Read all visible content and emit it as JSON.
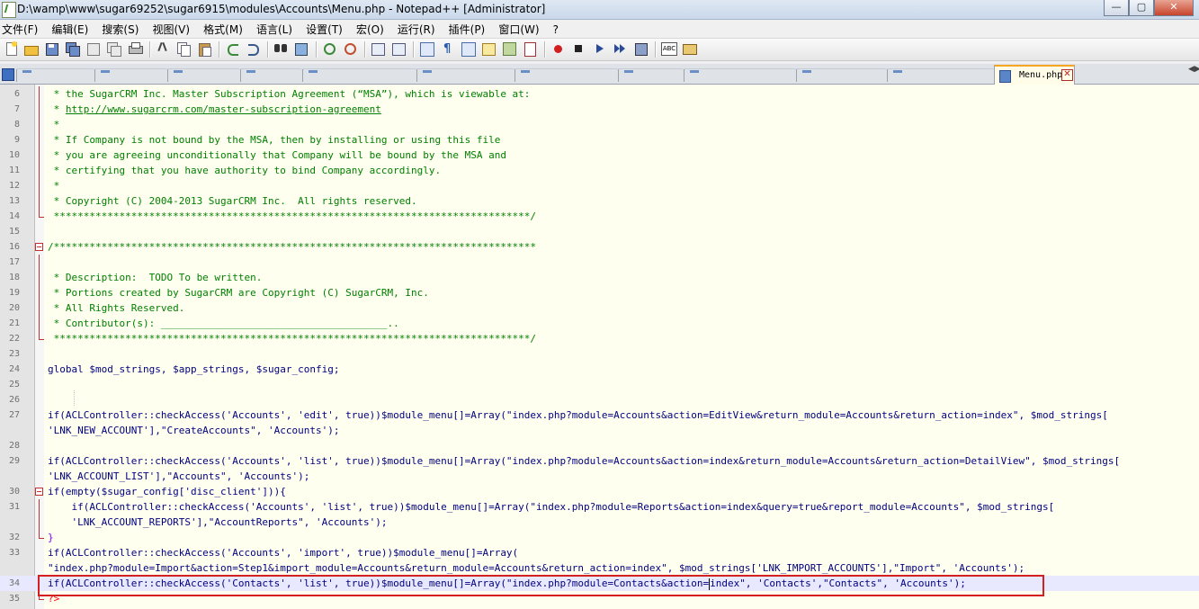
{
  "window": {
    "title": "D:\\wamp\\www\\sugar69252\\sugar6915\\modules\\Accounts\\Menu.php - Notepad++ [Administrator]",
    "minimize": "—",
    "maximize": "▢",
    "close": "✕"
  },
  "menu": [
    "文件(F)",
    "编辑(E)",
    "搜索(S)",
    "视图(V)",
    "格式(M)",
    "语言(L)",
    "设置(T)",
    "宏(O)",
    "运行(R)",
    "插件(P)",
    "窗口(W)",
    "?"
  ],
  "active_tab": {
    "label": "Menu.php",
    "close": "✕"
  },
  "tab_scroll": "◀▶",
  "colors": {
    "editor_bg": "#fffff0",
    "comment": "#008000",
    "keyword": "#0000ff",
    "string": "#808080",
    "highlight_box": "#d42020"
  },
  "editor": {
    "lines": [
      {
        "n": "6",
        "text": " * the SugarCRM Inc. Master Subscription Agreement (“MSA”), which is viewable at:"
      },
      {
        "n": "7",
        "text_pre": " * ",
        "link": "http://www.sugarcrm.com/master-subscription-agreement"
      },
      {
        "n": "8",
        "text": " *"
      },
      {
        "n": "9",
        "text": " * If Company is not bound by the MSA, then by installing or using this file"
      },
      {
        "n": "10",
        "text": " * you are agreeing unconditionally that Company will be bound by the MSA and"
      },
      {
        "n": "11",
        "text": " * certifying that you have authority to bind Company accordingly."
      },
      {
        "n": "12",
        "text": " *"
      },
      {
        "n": "13",
        "text": " * Copyright (C) 2004-2013 SugarCRM Inc.  All rights reserved."
      },
      {
        "n": "14",
        "text": " ********************************************************************************/"
      },
      {
        "n": "15",
        "text": ""
      },
      {
        "n": "16",
        "text": "/*********************************************************************************"
      },
      {
        "n": "17",
        "text": ""
      },
      {
        "n": "18",
        "text": " * Description:  TODO To be written."
      },
      {
        "n": "19",
        "text": " * Portions created by SugarCRM are Copyright (C) SugarCRM, Inc."
      },
      {
        "n": "20",
        "text": " * All Rights Reserved."
      },
      {
        "n": "21",
        "text": " * Contributor(s): ______________________________________.."
      },
      {
        "n": "22",
        "text": " ********************************************************************************/"
      },
      {
        "n": "23",
        "text": ""
      },
      {
        "n": "24",
        "text": "global $mod_strings, $app_strings, $sugar_config;"
      },
      {
        "n": "25",
        "text": ""
      },
      {
        "n": "26",
        "text": ""
      },
      {
        "n": "27",
        "a": "if(ACLController::checkAccess('Accounts', 'edit', true))$module_menu[]=Array(\"index.php?module=Accounts&action=EditView&return_module=Accounts&return_action=index\", $mod_strings[",
        "b": "'LNK_NEW_ACCOUNT'],\"CreateAccounts\", 'Accounts');"
      },
      {
        "n": "28",
        "text": ""
      },
      {
        "n": "29",
        "a": "if(ACLController::checkAccess('Accounts', 'list', true))$module_menu[]=Array(\"index.php?module=Accounts&action=index&return_module=Accounts&return_action=DetailView\", $mod_strings[",
        "b": "'LNK_ACCOUNT_LIST'],\"Accounts\", 'Accounts');"
      },
      {
        "n": "30",
        "text": "if(empty($sugar_config['disc_client'])){"
      },
      {
        "n": "31",
        "a": "    if(ACLController::checkAccess('Accounts', 'list', true))$module_menu[]=Array(\"index.php?module=Reports&action=index&query=true&report_module=Accounts\", $mod_strings[",
        "b": "    'LNK_ACCOUNT_REPORTS'],\"AccountReports\", 'Accounts');"
      },
      {
        "n": "32",
        "text": "}"
      },
      {
        "n": "33",
        "a": "if(ACLController::checkAccess('Accounts', 'import', true))$module_menu[]=Array(",
        "b": "\"index.php?module=Import&action=Step1&import_module=Accounts&return_module=Accounts&return_action=index\", $mod_strings['LNK_IMPORT_ACCOUNTS'],\"Import\", 'Accounts');"
      },
      {
        "n": "34",
        "pre": "if(ACLController::checkAccess('Contacts', 'list', true))$module_menu[]=Array(\"index.php?module=Contacts&action=",
        "post": "index\", 'Contacts',\"Contacts\", 'Accounts');"
      },
      {
        "n": "35",
        "text": "?>"
      }
    ]
  }
}
